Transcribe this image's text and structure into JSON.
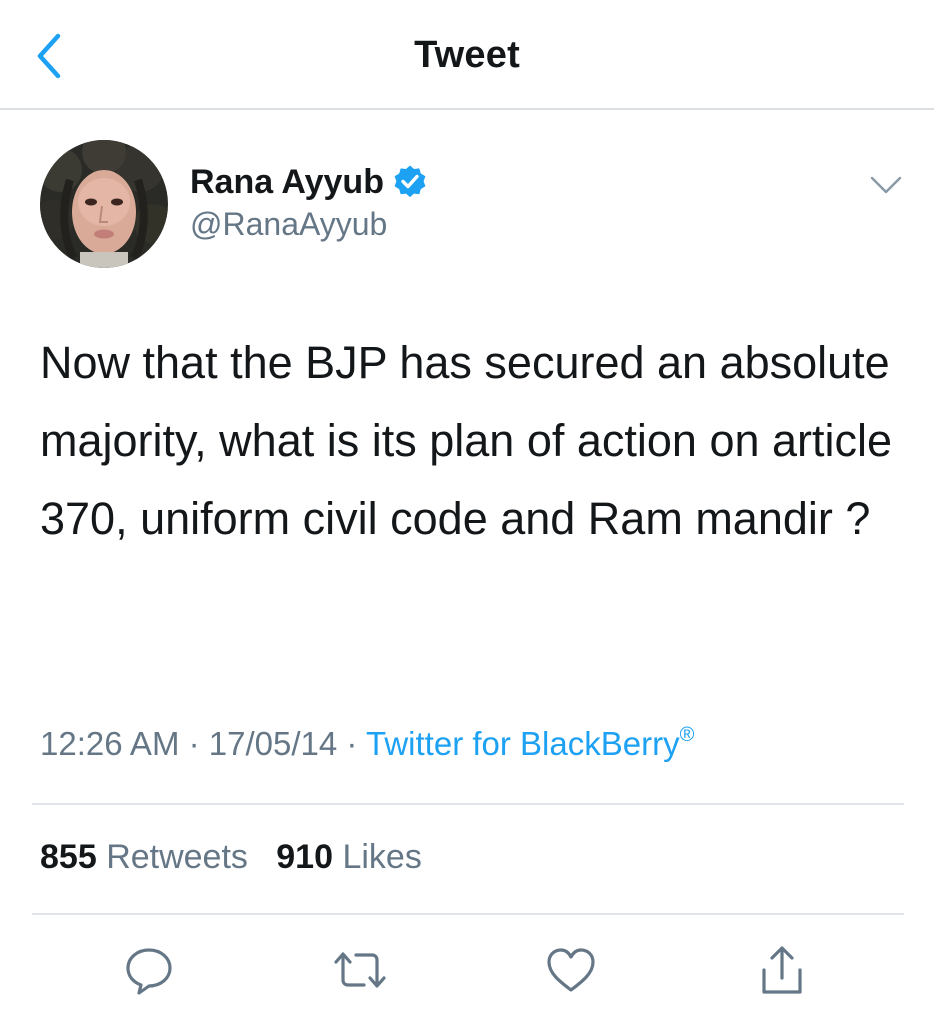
{
  "header": {
    "title": "Tweet",
    "back_icon": "chevron-left-icon",
    "accent": "#1da1f2"
  },
  "author": {
    "display_name": "Rana Ayyub",
    "handle": "@RanaAyyub",
    "verified": true,
    "verified_icon": "verified-badge-icon"
  },
  "tweet": {
    "text": "Now that the BJP has secured an absolute majority, what is its plan of action on article 370, uniform civil code and Ram mandir ?",
    "time": "12:26 AM",
    "date": "17/05/14",
    "separator": "·",
    "source": "Twitter for BlackBerry",
    "source_mark": "®"
  },
  "stats": {
    "retweets_count": "855",
    "retweets_label": "Retweets",
    "likes_count": "910",
    "likes_label": "Likes"
  },
  "actions": [
    {
      "icon": "reply-icon"
    },
    {
      "icon": "retweet-icon"
    },
    {
      "icon": "like-icon"
    },
    {
      "icon": "share-icon"
    }
  ],
  "colors": {
    "text_primary": "#14171a",
    "text_secondary": "#657786",
    "link": "#1da1f2",
    "divider": "#e1e5e9"
  }
}
